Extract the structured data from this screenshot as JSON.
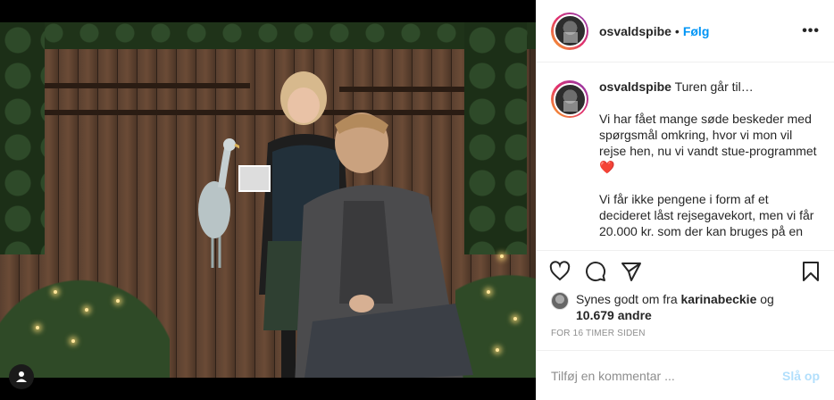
{
  "post": {
    "username": "osvaldspibe",
    "follow_label": "Følg",
    "dot": "•",
    "more_label": "•••"
  },
  "caption": {
    "username": "osvaldspibe",
    "lead": "Turen går til…",
    "para1": "Vi har fået mange søde beskeder med spørgsmål omkring, hvor vi mon vil rejse hen, nu vi vandt stue-programmet",
    "heart": "❤️",
    "para2": "Vi får ikke pengene i form af et decideret låst rejsegavekort, men vi får 20.000 kr. som der kan bruges på en"
  },
  "likes": {
    "prefix": "Synes godt om fra",
    "user": "karinabeckie",
    "and": "og",
    "count": "10.679 andre"
  },
  "timestamp": "FOR 16 TIMER SIDEN",
  "comment": {
    "placeholder": "Tilføj en kommentar ...",
    "post_label": "Slå op"
  },
  "icons": {
    "like": "heart-outline-icon",
    "comment": "comment-bubble-icon",
    "share": "paper-plane-icon",
    "save": "bookmark-icon",
    "tag": "user-tag-icon"
  },
  "colors": {
    "link": "#0095f6",
    "post_disabled": "#b2dffc",
    "muted": "#8e8e8e",
    "text": "#262626"
  }
}
